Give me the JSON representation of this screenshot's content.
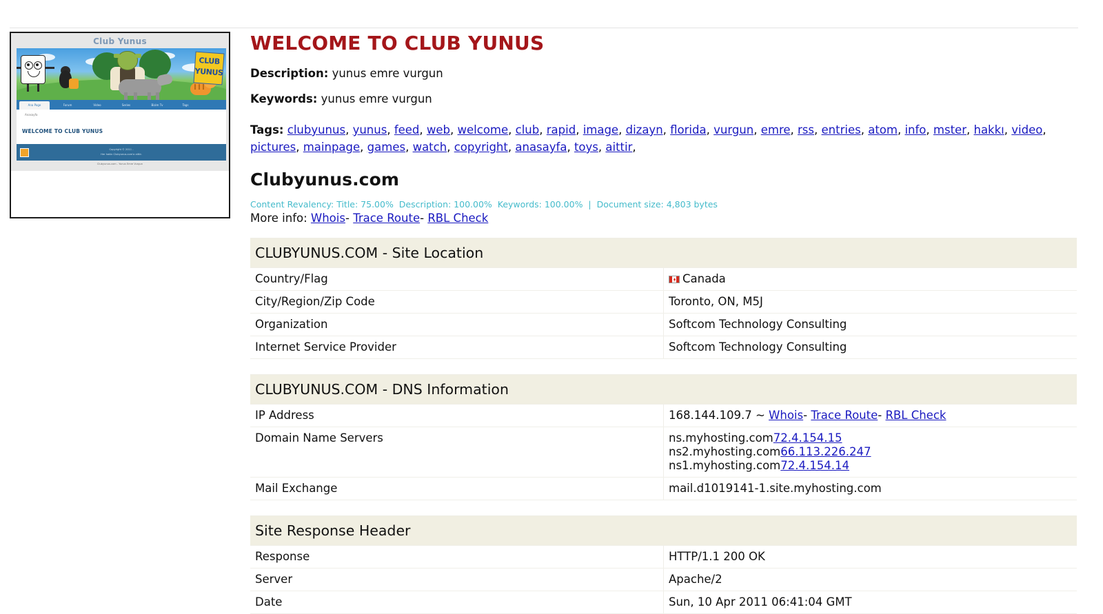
{
  "thumbnail": {
    "alt": "Club Yunus website preview",
    "header_title": "Club Yunus",
    "badge_line1": "CLUB",
    "badge_line2": "YUNUS",
    "nav_items": [
      "Ana Page",
      "Forum",
      "Video",
      "Series",
      "Bizim Tv",
      "Tags"
    ],
    "breadcrumb": "Anasayfa",
    "page_heading": "WELCOME TO CLUB YUNUS",
    "footer_line1": "Copyright © 2011 -",
    "footer_line2": "Her hakkı Clubyunus.com'a aittir.",
    "credit": "Clubyunus.com - Yunus Emre Vurgun"
  },
  "header": {
    "title": "WELCOME TO CLUB YUNUS"
  },
  "meta": {
    "description_label": "Description:",
    "description_value": "yunus emre vurgun",
    "keywords_label": "Keywords:",
    "keywords_value": "yunus emre vurgun",
    "tags_label": "Tags:",
    "tags": [
      "clubyunus",
      "yunus",
      "feed",
      "web",
      "welcome",
      "club",
      "rapid",
      "image",
      "dizayn",
      "florida",
      "vurgun",
      "emre",
      "rss",
      "entries",
      "atom",
      "info",
      "mster",
      "hakkı",
      "video",
      "pictures",
      "mainpage",
      "games",
      "watch",
      "copyright",
      "anasayfa",
      "toys",
      "aittir"
    ]
  },
  "domain": {
    "name": "Clubyunus.com",
    "relevancy_prefix": "Content Revalency:",
    "relevancy_title": "Title: 75.00%",
    "relevancy_description": "Description: 100.00%",
    "relevancy_keywords": "Keywords: 100.00%",
    "relevancy_separator": "|",
    "document_size": "Document size: 4,803 bytes",
    "more_info_label": "More info:",
    "more_info_links": [
      "Whois",
      "Trace Route",
      "RBL Check"
    ],
    "link_separator": "-"
  },
  "site_location": {
    "heading": "CLUBYUNUS.COM - Site Location",
    "rows": [
      {
        "label": "Country/Flag",
        "value": "Canada",
        "icon": "canada-flag-icon"
      },
      {
        "label": "City/Region/Zip Code",
        "value": "Toronto, ON, M5J"
      },
      {
        "label": "Organization",
        "value": "Softcom Technology Consulting"
      },
      {
        "label": "Internet Service Provider",
        "value": "Softcom Technology Consulting"
      }
    ]
  },
  "dns_information": {
    "heading": "CLUBYUNUS.COM - DNS Information",
    "ip_label": "IP Address",
    "ip_value": "168.144.109.7",
    "ip_tilde": "~",
    "ip_links": [
      "Whois",
      "Trace Route",
      "RBL Check"
    ],
    "ns_label": "Domain Name Servers",
    "nameservers": [
      {
        "host": "ns.myhosting.com",
        "ip": "72.4.154.15"
      },
      {
        "host": "ns2.myhosting.com",
        "ip": "66.113.226.247"
      },
      {
        "host": "ns1.myhosting.com",
        "ip": "72.4.154.14"
      }
    ],
    "mx_label": "Mail Exchange",
    "mx_value": "mail.d1019141-1.site.myhosting.com"
  },
  "response_header": {
    "heading": "Site Response Header",
    "rows": [
      {
        "label": "Response",
        "value": "HTTP/1.1 200 OK"
      },
      {
        "label": "Server",
        "value": "Apache/2"
      },
      {
        "label": "Date",
        "value": "Sun, 10 Apr 2011 06:41:04 GMT"
      }
    ]
  },
  "colors": {
    "title_red": "#A4161A",
    "link_blue": "#1a1ac0",
    "relevancy_teal": "#45BBCB",
    "section_header_bg": "#F1EFE2",
    "flag_red": "#D52B1E"
  }
}
